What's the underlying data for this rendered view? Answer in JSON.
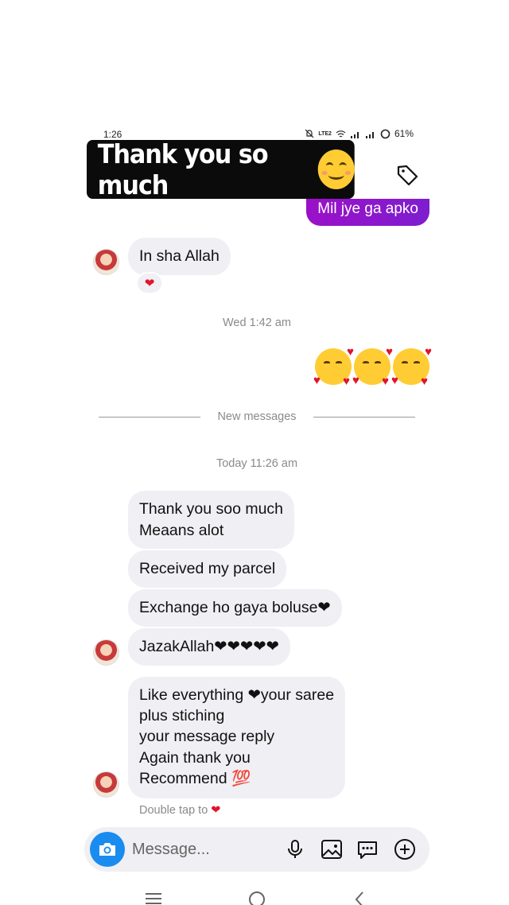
{
  "status_bar": {
    "time": "1:26",
    "network": "LTE2",
    "battery": "61%"
  },
  "caption": {
    "text": "Thank you so much"
  },
  "thread": {
    "sent_partial": "Mil jye ga apko",
    "msg_in_sha_allah": "In sha Allah",
    "reaction": "❤",
    "timestamp_wed": "Wed 1:42 am",
    "new_messages_label": "New messages",
    "timestamp_today": "Today 11:26 am",
    "messages": [
      "Thank you soo much\nMeaans alot",
      "Received my parcel",
      "Exchange ho gaya boluse❤",
      "JazakAllah❤❤❤❤❤",
      "Like everything ❤your saree\nplus stiching\nyour message reply\nAgain thank you\nRecommend 💯"
    ],
    "double_tap_hint": "Double tap to",
    "double_tap_heart": "❤"
  },
  "composer": {
    "placeholder": "Message..."
  },
  "colors": {
    "sent_bubble": "#8a15cc",
    "received_bubble": "#efeff4",
    "camera_button": "#1a8cf0",
    "heart": "#e0142b"
  },
  "icons": [
    "tag-icon",
    "camera-icon",
    "microphone-icon",
    "gallery-icon",
    "sticker-icon",
    "plus-icon",
    "menu-icon",
    "home-icon",
    "back-icon"
  ]
}
